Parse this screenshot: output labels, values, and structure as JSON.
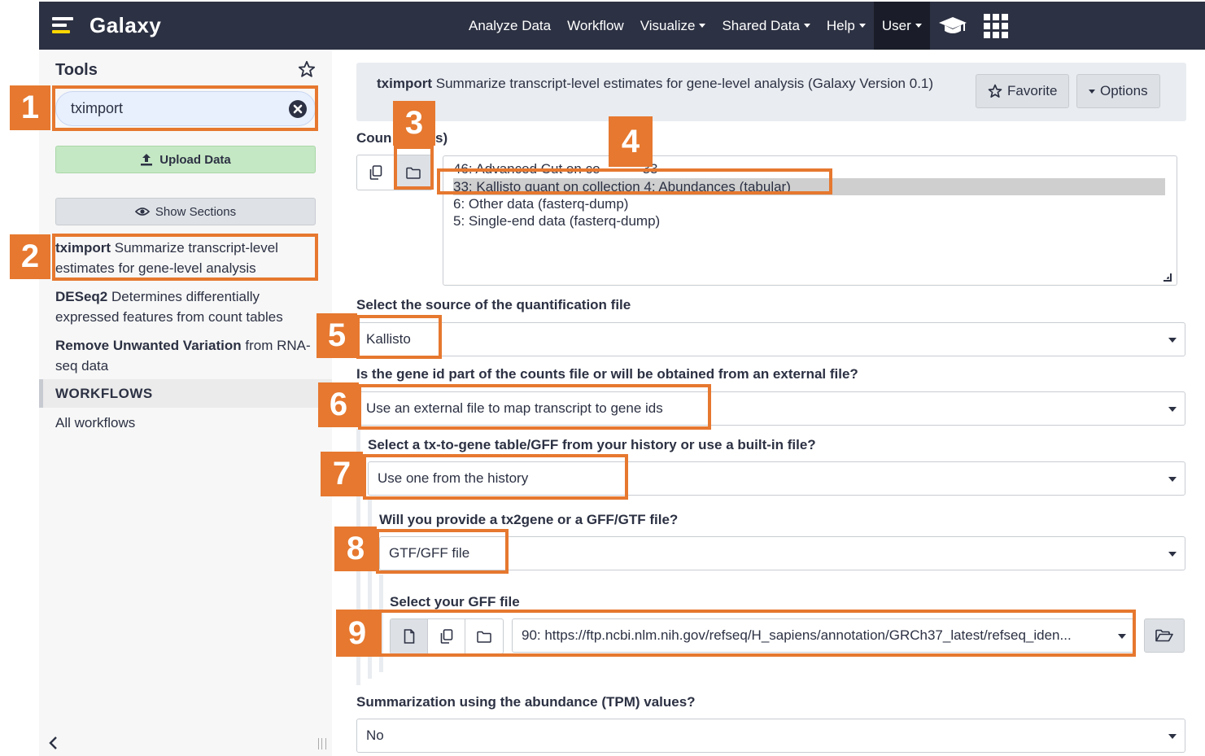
{
  "navbar": {
    "brand": "Galaxy",
    "items": [
      {
        "label": "Analyze Data"
      },
      {
        "label": "Workflow"
      },
      {
        "label": "Visualize"
      },
      {
        "label": "Shared Data"
      },
      {
        "label": "Help"
      },
      {
        "label": "User"
      }
    ]
  },
  "tool_panel": {
    "title": "Tools",
    "search_value": "tximport",
    "upload_label": "Upload Data",
    "sections_label": "Show Sections",
    "tools": [
      {
        "name": "tximport",
        "desc": "Summarize transcript-level estimates for gene-level analysis"
      },
      {
        "name": "DESeq2",
        "desc": "Determines differentially expressed features from count tables"
      },
      {
        "name": "Remove Unwanted Variation",
        "desc": "from RNA-seq data"
      }
    ],
    "workflows_header": "WORKFLOWS",
    "all_workflows": "All workflows"
  },
  "tool_form": {
    "tool_name": "tximport",
    "tool_desc": "Summarize transcript-level estimates for gene-level analysis (Galaxy Version 0.1)",
    "favorite_label": "Favorite",
    "options_label": "Options",
    "counts_label_left": "Coun",
    "counts_label_right": "s)",
    "counts_items": [
      "46: Advanced Cut on co",
      "33: Kallisto quant on collection 4: Abundances (tabular)",
      "6: Other data (fasterq-dump)",
      "5: Single-end data (fasterq-dump)"
    ],
    "counts_item0_tail": "33",
    "source_label": "Select the source of the quantification file",
    "source_value": "Kallisto",
    "geneid_label": "Is the gene id part of the counts file or will be obtained from an external file?",
    "geneid_value": "Use an external file to map transcript to gene ids",
    "txgene_label": "Select a tx-to-gene table/GFF from your history or use a built-in file?",
    "txgene_value": "Use one from the history",
    "provide_label": "Will you provide a tx2gene or a GFF/GTF file?",
    "provide_value": "GTF/GFF file",
    "gff_label": "Select your GFF file",
    "gff_value": "90: https://ftp.ncbi.nlm.nih.gov/refseq/H_sapiens/annotation/GRCh37_latest/refseq_iden...",
    "tpm_label": "Summarization using the abundance (TPM) values?",
    "tpm_value": "No"
  },
  "annotations": [
    "1",
    "2",
    "3",
    "4",
    "5",
    "6",
    "7",
    "8",
    "9"
  ],
  "colors": {
    "navbar": "#2c3143",
    "annotation": "#e6782f",
    "upload": "#c5e8c4"
  }
}
